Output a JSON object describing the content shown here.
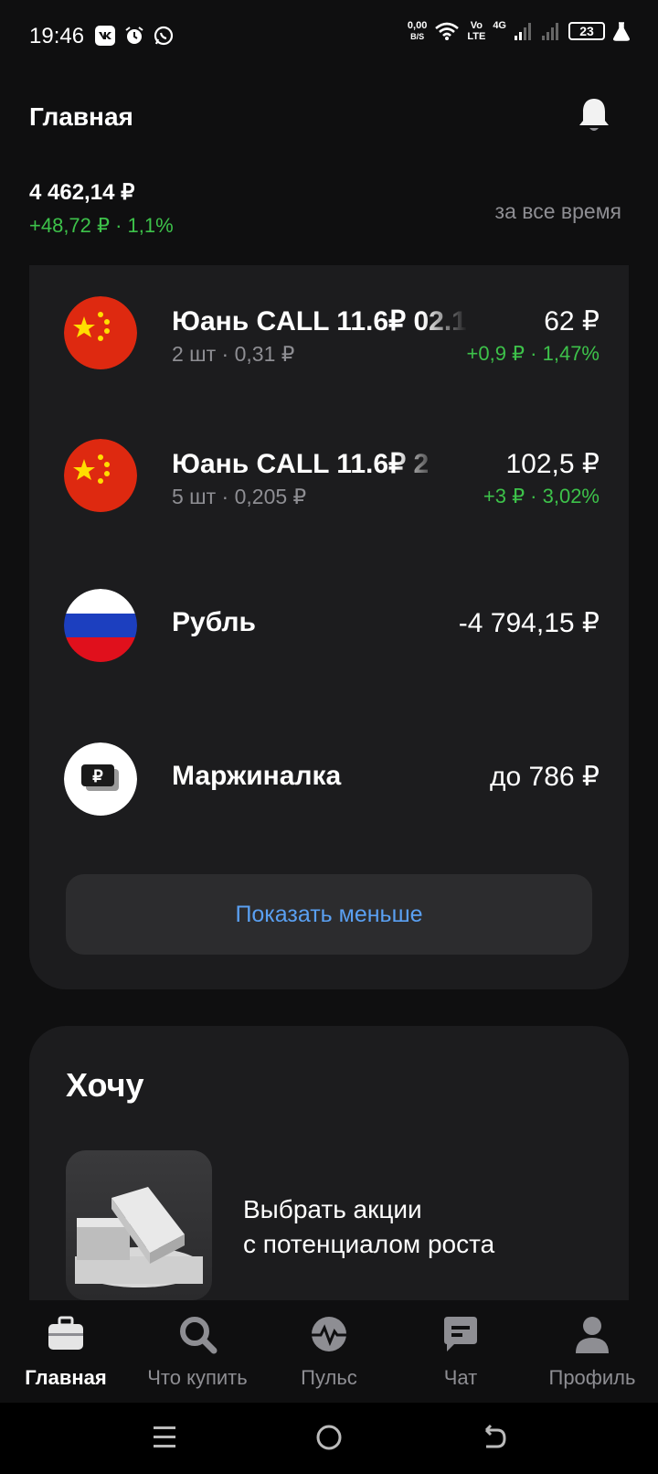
{
  "status_bar": {
    "time": "19:46",
    "net_speed_value": "0,00",
    "net_speed_unit": "B/S",
    "volte_top": "Vo",
    "volte_bottom": "LTE",
    "network": "4G",
    "battery": "23",
    "icons": [
      "vk-icon",
      "alarm-icon",
      "whatsapp-icon",
      "wifi-icon",
      "signal-icon",
      "battery-icon",
      "flask-icon"
    ]
  },
  "header": {
    "title": "Главная"
  },
  "portfolio": {
    "total": "4 462,14 ₽",
    "change": "+48,72 ₽ · 1,1%",
    "period": "за все время"
  },
  "holdings": [
    {
      "name": "Юань CALL 11.6₽ 02.1",
      "sub": "2 шт · 0,31 ₽",
      "value": "62 ₽",
      "change": "+0,9 ₽ · 1,47%",
      "icon": "china-flag-icon"
    },
    {
      "name": "Юань CALL 11.6₽ 2",
      "sub": "5 шт · 0,205 ₽",
      "value": "102,5 ₽",
      "change": "+3 ₽ · 3,02%",
      "icon": "china-flag-icon"
    },
    {
      "name": "Рубль",
      "value": "-4 794,15 ₽",
      "icon": "russia-flag-icon"
    },
    {
      "name": "Маржиналка",
      "value": "до 786 ₽",
      "icon": "ruble-card-icon"
    }
  ],
  "show_less": "Показать меньше",
  "want": {
    "title": "Хочу",
    "promo_line1": "Выбрать акции",
    "promo_line2": "с потенциалом роста"
  },
  "tabs": [
    {
      "label": "Главная",
      "icon": "briefcase-icon",
      "active": true
    },
    {
      "label": "Что купить",
      "icon": "search-icon",
      "active": false
    },
    {
      "label": "Пульс",
      "icon": "pulse-icon",
      "active": false
    },
    {
      "label": "Чат",
      "icon": "chat-icon",
      "active": false
    },
    {
      "label": "Профиль",
      "icon": "profile-icon",
      "active": false
    }
  ],
  "colors": {
    "positive": "#3dc24a",
    "link": "#5aa0f2",
    "muted": "#8e8e93",
    "card": "#1c1c1e",
    "background": "#0f0f10"
  }
}
